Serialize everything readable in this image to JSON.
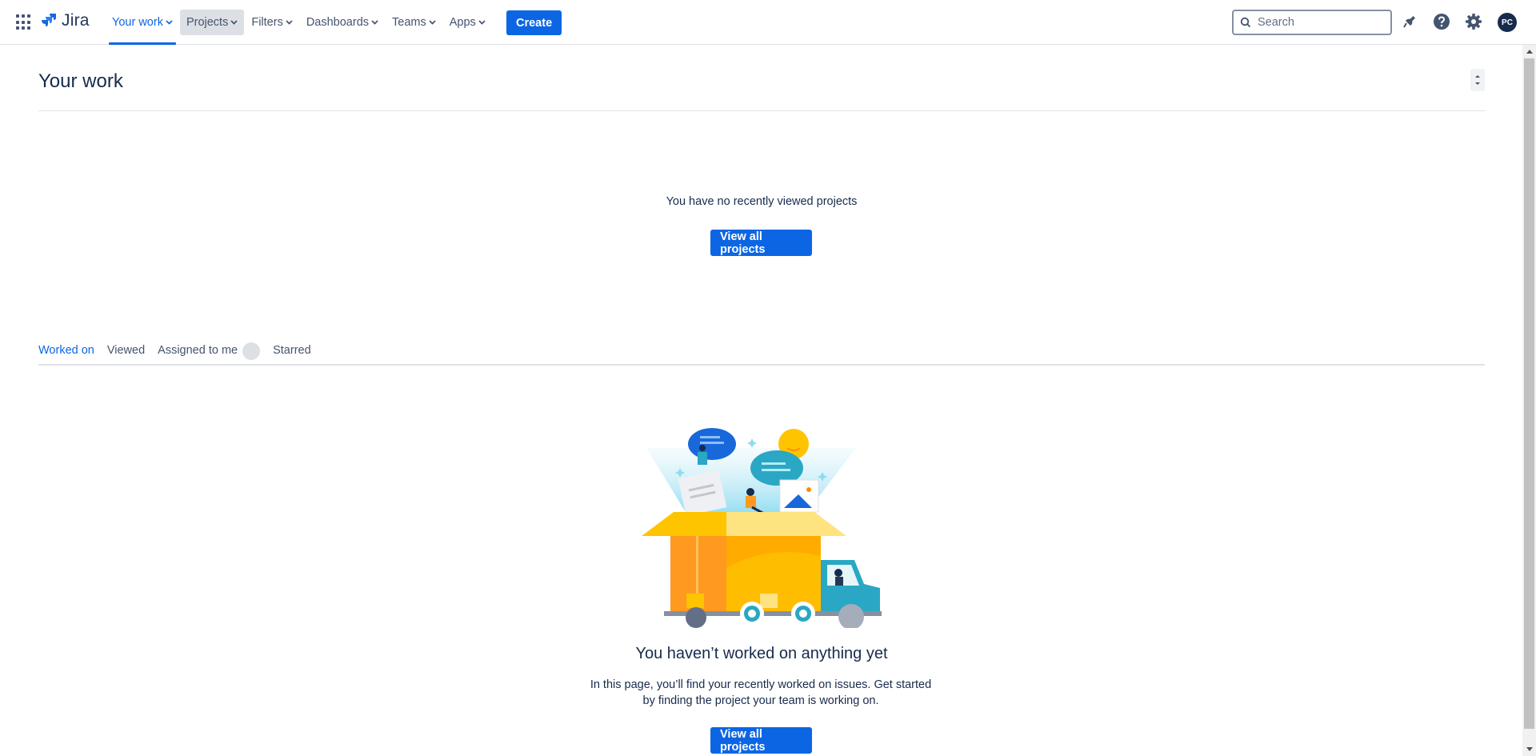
{
  "app": {
    "name": "Jira"
  },
  "nav": {
    "items": [
      {
        "label": "Your work",
        "active": true
      },
      {
        "label": "Projects",
        "hover": true
      },
      {
        "label": "Filters"
      },
      {
        "label": "Dashboards"
      },
      {
        "label": "Teams"
      },
      {
        "label": "Apps"
      }
    ],
    "create_label": "Create",
    "search_placeholder": "Search",
    "avatar_initials": "PC"
  },
  "page": {
    "title": "Your work",
    "recent_projects_empty": "You have no recently viewed projects",
    "view_all_projects_label": "View all projects",
    "tabs": [
      {
        "label": "Worked on",
        "active": true
      },
      {
        "label": "Viewed"
      },
      {
        "label": "Assigned to me",
        "badge": true
      },
      {
        "label": "Starred"
      }
    ],
    "empty_title": "You haven’t worked on anything yet",
    "empty_description": "In this page, you’ll find your recently worked on issues. Get started by finding the project your team is working on.",
    "view_all_projects_label_2": "View all projects"
  },
  "colors": {
    "brand_blue": "#0c66e4",
    "text_primary": "#172b4d",
    "text_subtle": "#44546f"
  },
  "icons": [
    "app-switcher-icon",
    "jira-logo-icon",
    "search-icon",
    "notifications-icon",
    "help-icon",
    "settings-icon"
  ]
}
